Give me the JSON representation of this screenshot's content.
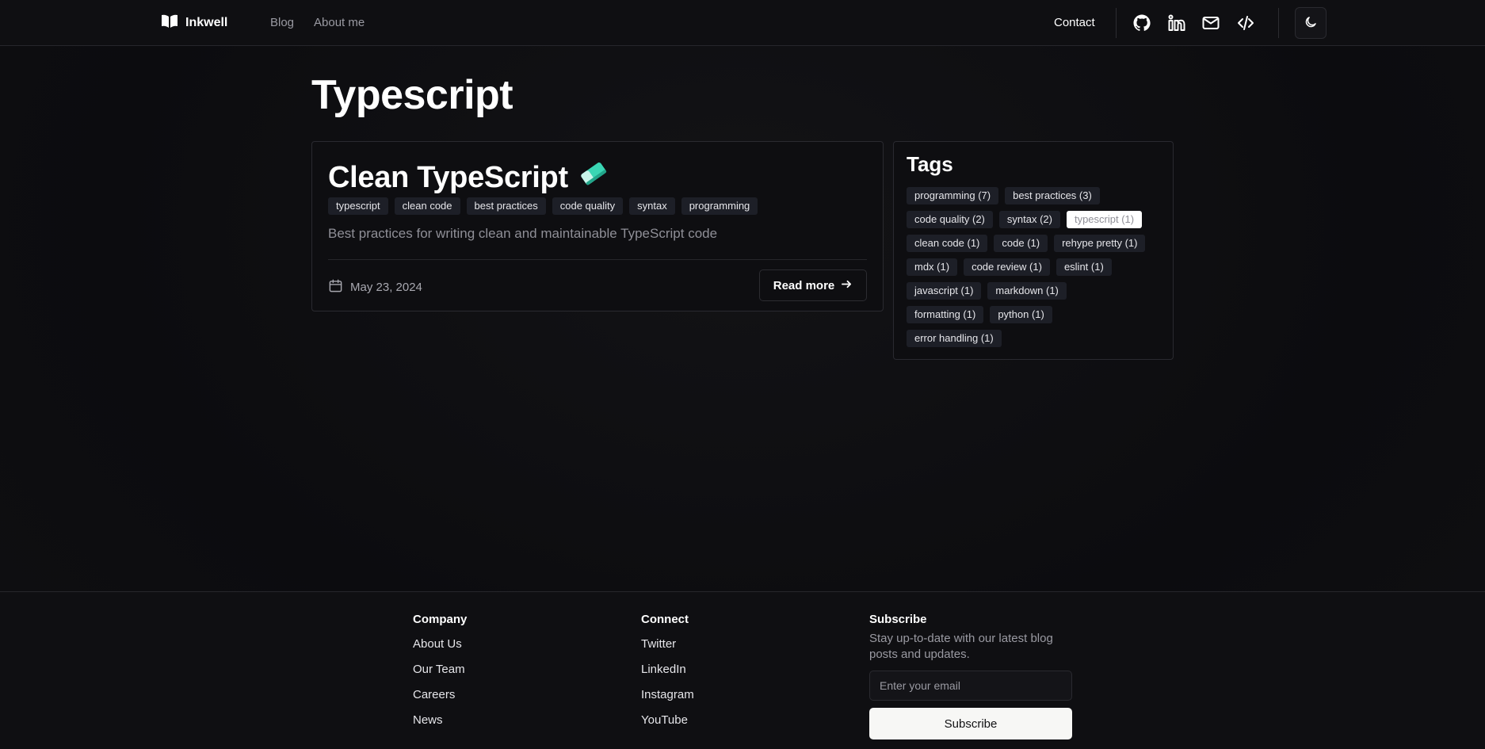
{
  "header": {
    "logo_text": "Inkwell",
    "nav": [
      {
        "label": "Blog"
      },
      {
        "label": "About me"
      }
    ],
    "contact_label": "Contact",
    "icons": [
      "github-icon",
      "linkedin-icon",
      "mail-icon",
      "code-icon"
    ],
    "theme_icon": "moon-icon"
  },
  "page": {
    "title": "Typescript"
  },
  "post": {
    "title": "Clean TypeScript",
    "title_icon": "eraser-icon",
    "tags": [
      "typescript",
      "clean code",
      "best practices",
      "code quality",
      "syntax",
      "programming"
    ],
    "description": "Best practices for writing clean and maintainable TypeScript code",
    "date": "May 23, 2024",
    "read_more_label": "Read more"
  },
  "tags_panel": {
    "title": "Tags",
    "rows": [
      [
        "programming (7)",
        "best practices (3)"
      ],
      [
        "code quality (2)",
        "syntax (2)",
        "typescript (1)"
      ],
      [
        "clean code (1)",
        "code (1)",
        "rehype pretty (1)"
      ],
      [
        "mdx (1)",
        "code review (1)",
        "eslint (1)"
      ],
      [
        "javascript (1)",
        "markdown (1)"
      ],
      [
        "formatting (1)",
        "python (1)"
      ],
      [
        "error handling (1)"
      ]
    ],
    "active": "typescript (1)"
  },
  "footer": {
    "company": {
      "heading": "Company",
      "links": [
        "About Us",
        "Our Team",
        "Careers",
        "News"
      ]
    },
    "connect": {
      "heading": "Connect",
      "links": [
        "Twitter",
        "LinkedIn",
        "Instagram",
        "YouTube"
      ]
    },
    "subscribe": {
      "heading": "Subscribe",
      "text": "Stay up-to-date with our latest blog posts and updates.",
      "placeholder": "Enter your email",
      "button_label": "Subscribe"
    }
  }
}
